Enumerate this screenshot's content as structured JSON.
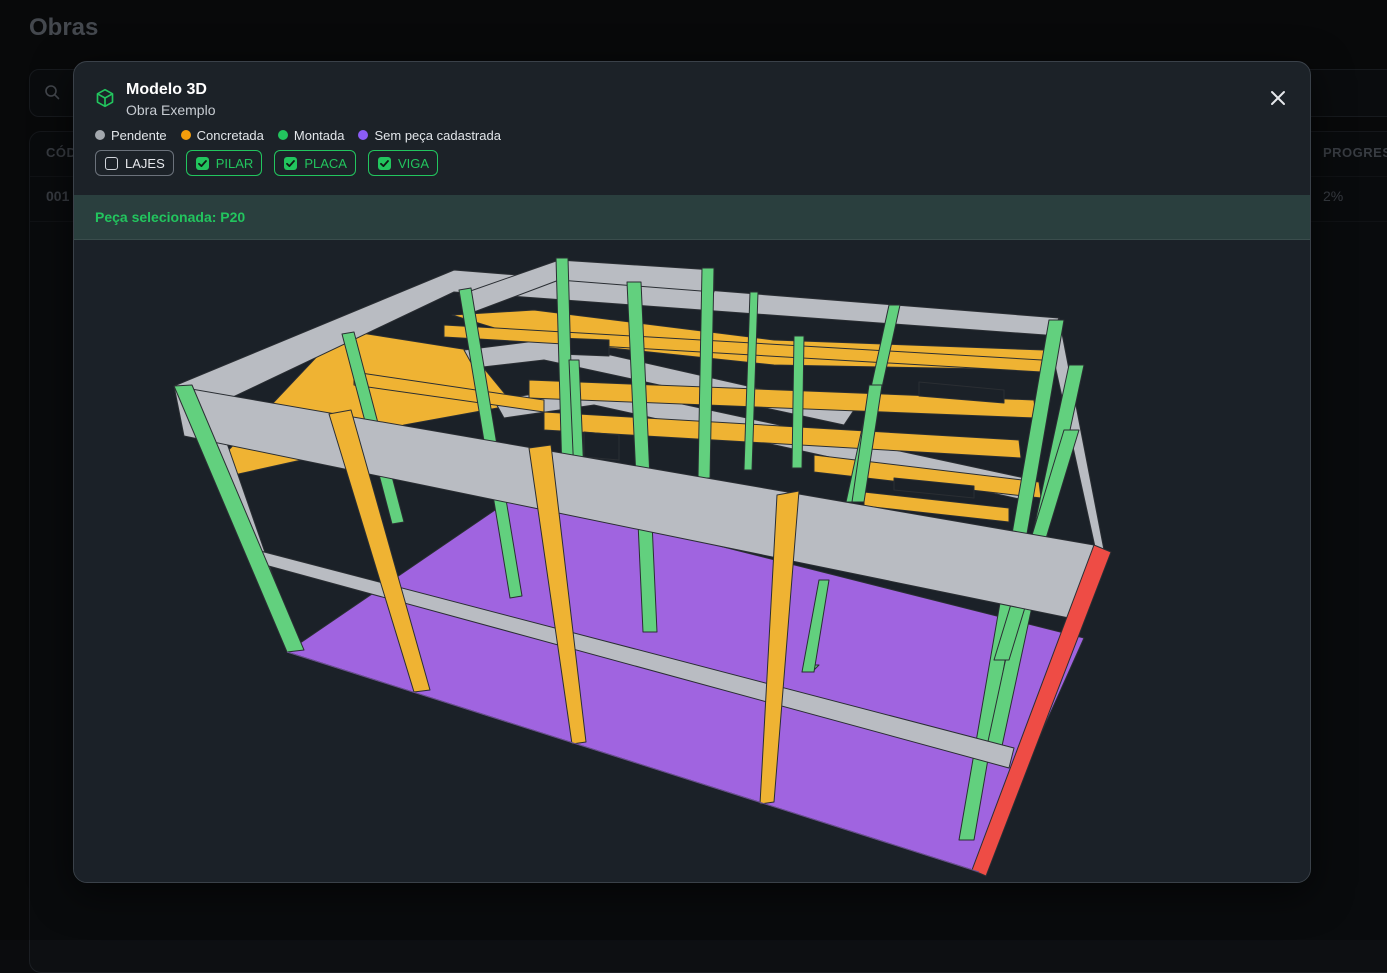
{
  "page": {
    "title": "Obras"
  },
  "table": {
    "headers": {
      "codigo": "CÓD",
      "progresso": "PROGRESS"
    },
    "row": {
      "codigo": "001",
      "progresso": "2%"
    }
  },
  "modal": {
    "title": "Modelo 3D",
    "subtitle": "Obra Exemplo",
    "legend": [
      {
        "label": "Pendente",
        "color": "#a3a8ae"
      },
      {
        "label": "Concretada",
        "color": "#f59e0b"
      },
      {
        "label": "Montada",
        "color": "#22c55e"
      },
      {
        "label": "Sem peça cadastrada",
        "color": "#8b5cf6"
      }
    ],
    "filters": [
      {
        "label": "LAJES",
        "checked": false
      },
      {
        "label": "PILAR",
        "checked": true
      },
      {
        "label": "PLACA",
        "checked": true
      },
      {
        "label": "VIGA",
        "checked": true
      }
    ],
    "selected_piece": "Peça selecionada: P20"
  },
  "model_colors": {
    "pending": "#b9bcc2",
    "concreted": "#efb333",
    "mounted": "#62d07e",
    "no_piece": "#a064e0",
    "selected": "#ee4c45"
  },
  "icons": {
    "search": "search-icon",
    "cube": "cube-icon",
    "close": "close-icon",
    "check": "check-icon"
  }
}
